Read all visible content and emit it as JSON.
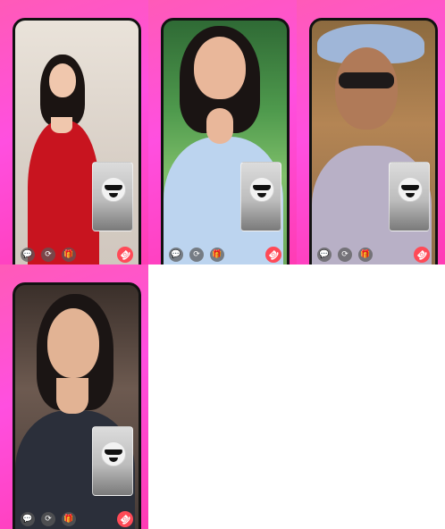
{
  "calls": [
    {
      "id": "call-1",
      "controls": {
        "chat_icon": "💬",
        "switch_camera_icon": "⟳",
        "gift_icon": "🎁",
        "hangup_icon": "☎"
      }
    },
    {
      "id": "call-2",
      "controls": {
        "chat_icon": "💬",
        "switch_camera_icon": "⟳",
        "gift_icon": "🎁",
        "hangup_icon": "☎"
      }
    },
    {
      "id": "call-3",
      "controls": {
        "chat_icon": "💬",
        "switch_camera_icon": "⟳",
        "gift_icon": "🎁",
        "hangup_icon": "☎"
      }
    },
    {
      "id": "call-4",
      "controls": {
        "chat_icon": "💬",
        "switch_camera_icon": "⟳",
        "gift_icon": "🎁",
        "hangup_icon": "☎"
      }
    }
  ],
  "colors": {
    "tile_gradient_start": "#ff5ab8",
    "tile_gradient_end": "#ff3cb4",
    "hangup": "#ff4a57",
    "control_bg": "#5a5a5a",
    "pip_border": "#ffffff"
  }
}
